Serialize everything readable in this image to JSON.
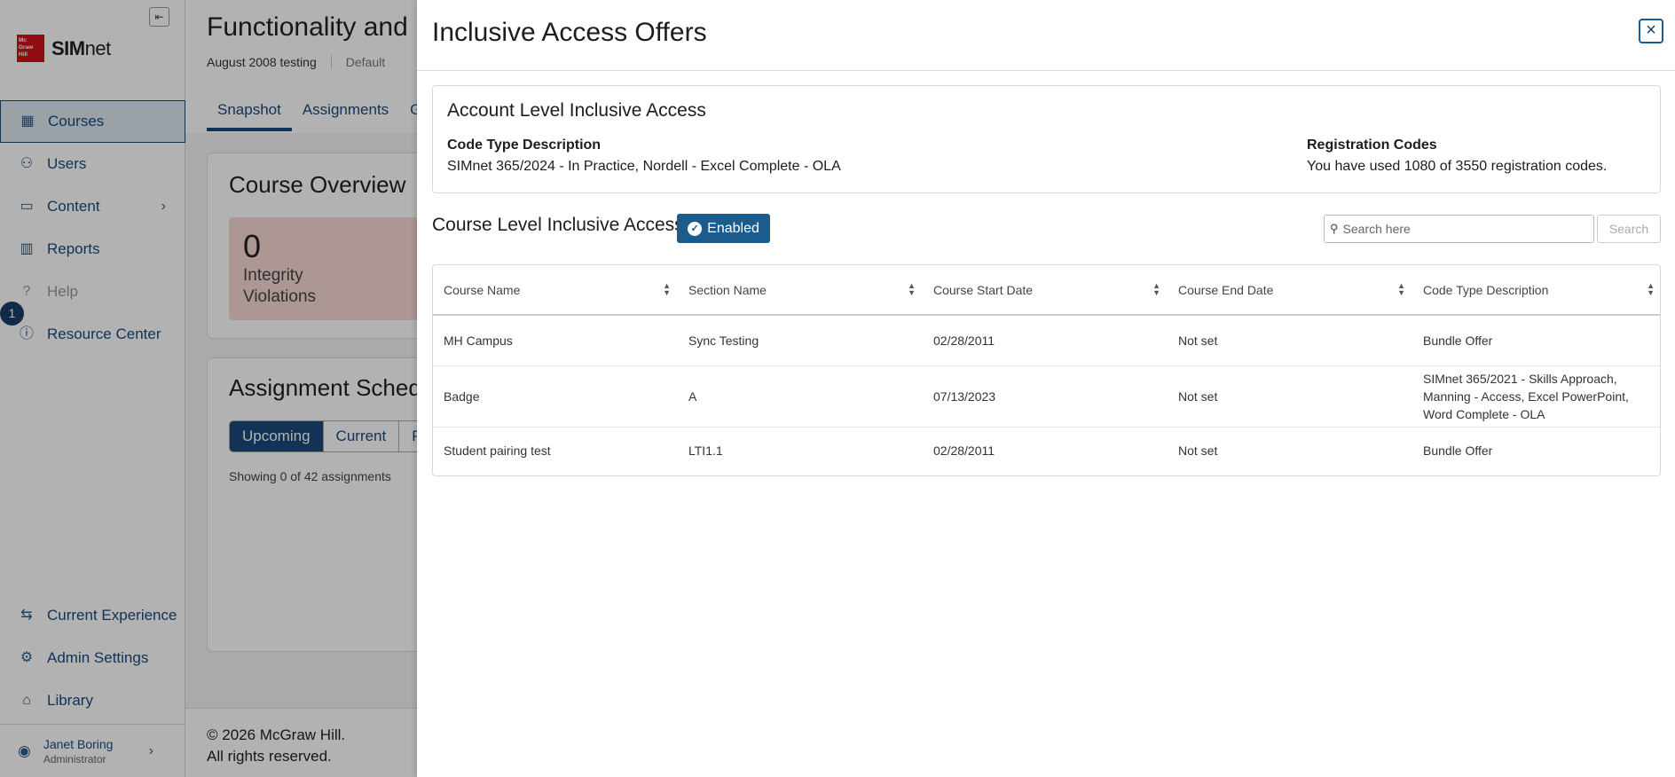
{
  "sidebar": {
    "logo_text": "McGraw Hill",
    "app_name_bold": "SIM",
    "app_name_rest": "net",
    "items": [
      {
        "label": "Courses",
        "icon": "courses-icon"
      },
      {
        "label": "Users",
        "icon": "users-icon"
      },
      {
        "label": "Content",
        "icon": "content-icon"
      },
      {
        "label": "Reports",
        "icon": "reports-icon"
      },
      {
        "label": "Help",
        "icon": "help-icon"
      },
      {
        "label": "Resource Center",
        "icon": "resource-center-icon"
      }
    ],
    "notification_count": "1",
    "bottom_items": [
      {
        "label": "Current Experience",
        "icon": "swap-icon"
      },
      {
        "label": "Admin Settings",
        "icon": "gear-icon"
      },
      {
        "label": "Library",
        "icon": "library-icon"
      }
    ],
    "user": {
      "name": "Janet Boring",
      "role": "Administrator"
    }
  },
  "main": {
    "title": "Functionality and P",
    "subtitle": "August 2008 testing",
    "subtitle_muted": "Default",
    "tabs": [
      "Snapshot",
      "Assignments",
      "Gra"
    ],
    "overview_title": "Course Overview",
    "stat_value": "0",
    "stat_label_1": "Integrity",
    "stat_label_2": "Violations",
    "schedule_title": "Assignment Schedu",
    "schedule_tabs": [
      "Upcoming",
      "Current",
      "Pa"
    ],
    "showing": "Showing 0 of 42 assignments",
    "footer_line1": "© 2026 McGraw Hill.",
    "footer_line2": "All rights reserved."
  },
  "modal": {
    "title": "Inclusive Access Offers",
    "close_label": "×",
    "account": {
      "title": "Account Level Inclusive Access",
      "code_type_label": "Code Type Description",
      "code_type_value": "SIMnet 365/2024 - In Practice, Nordell - Excel Complete - OLA",
      "reg_label": "Registration Codes",
      "reg_value": "You have used 1080 of 3550 registration codes."
    },
    "course_level": {
      "title": "Course Level Inclusive Access",
      "badge": "Enabled"
    },
    "search": {
      "placeholder": "Search here",
      "button": "Search"
    },
    "table": {
      "columns": [
        "Course Name",
        "Section Name",
        "Course Start Date",
        "Course End Date",
        "Code Type Description"
      ],
      "rows": [
        [
          "MH Campus",
          "Sync Testing",
          "02/28/2011",
          "Not set",
          "Bundle Offer"
        ],
        [
          "Badge",
          "A",
          "07/13/2023",
          "Not set",
          "SIMnet 365/2021 - Skills Approach, Manning - Access, Excel PowerPoint, Word Complete - OLA"
        ],
        [
          "Student pairing test",
          "LTI1.1",
          "02/28/2011",
          "Not set",
          "Bundle Offer"
        ]
      ]
    }
  }
}
